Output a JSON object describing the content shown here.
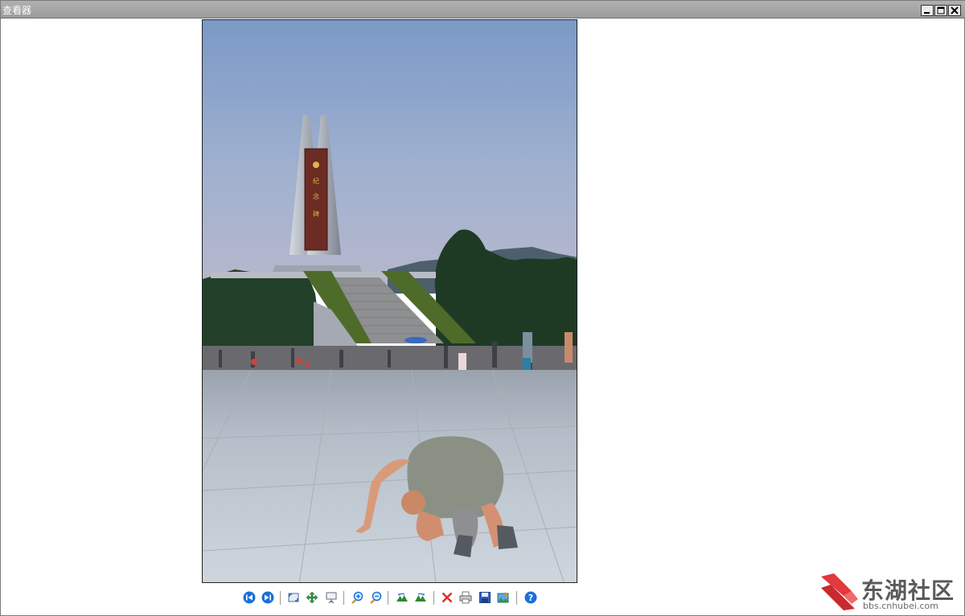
{
  "window": {
    "title": "查看器"
  },
  "photo": {
    "monument_inscription": "纪念碑"
  },
  "toolbar": {
    "buttons": [
      {
        "name": "previous-image-button",
        "icon": "skip-previous-icon"
      },
      {
        "name": "next-image-button",
        "icon": "skip-next-icon"
      },
      {
        "name": "fit-to-window-button",
        "icon": "fit-window-icon"
      },
      {
        "name": "actual-size-button",
        "icon": "move-arrows-icon"
      },
      {
        "name": "slideshow-button",
        "icon": "projector-icon"
      },
      {
        "name": "zoom-in-button",
        "icon": "zoom-in-icon"
      },
      {
        "name": "zoom-out-button",
        "icon": "zoom-out-icon"
      },
      {
        "name": "rotate-left-button",
        "icon": "rotate-left-icon"
      },
      {
        "name": "rotate-right-button",
        "icon": "rotate-right-icon"
      },
      {
        "name": "delete-button",
        "icon": "delete-x-icon"
      },
      {
        "name": "print-button",
        "icon": "printer-icon"
      },
      {
        "name": "save-button",
        "icon": "floppy-disk-icon"
      },
      {
        "name": "edit-image-button",
        "icon": "image-edit-icon"
      },
      {
        "name": "help-button",
        "icon": "help-icon"
      }
    ]
  },
  "watermark": {
    "name": "东湖社区",
    "url": "bbs.cnhubei.com"
  },
  "colors": {
    "titlebar": "#a6a6a6",
    "sky_top": "#7d9bc8",
    "sky_bottom": "#b3b8cf",
    "plaza": "#c2cad2",
    "accent_blue": "#1b6fd8",
    "watermark_red": "#e0393e"
  }
}
